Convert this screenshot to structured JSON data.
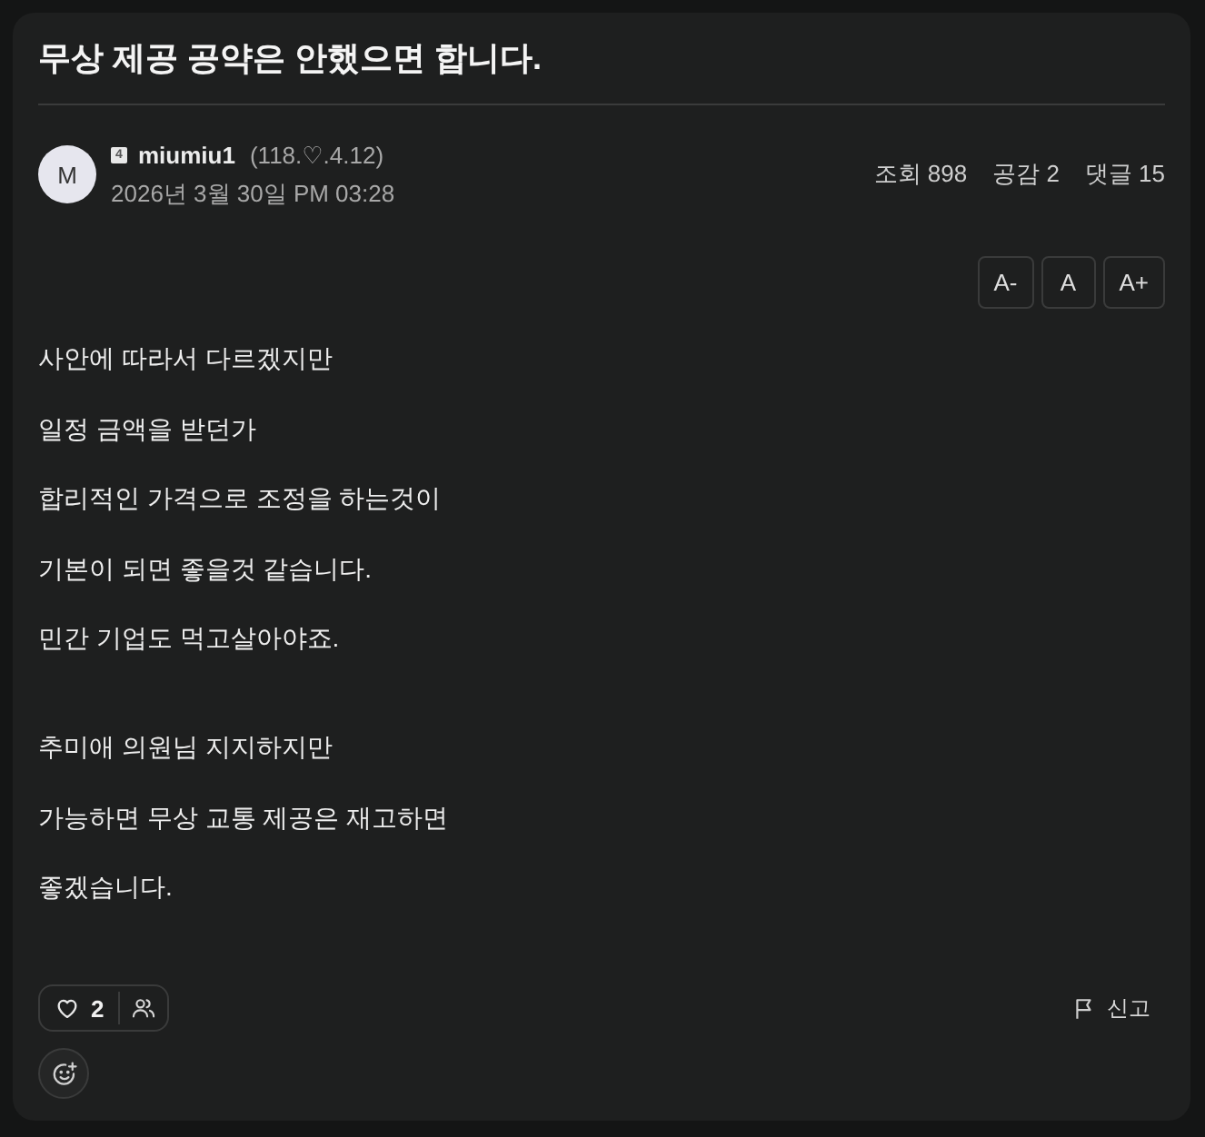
{
  "post": {
    "title": "무상 제공 공약은 안했으면 합니다."
  },
  "author": {
    "avatar_letter": "M",
    "level_badge": "4",
    "name": "miumiu1",
    "ip": "(118.♡.4.12)",
    "date": "2026년 3월 30일 PM 03:28"
  },
  "stats": [
    "조회 898",
    "공감 2",
    "댓글 15"
  ],
  "font_size_buttons": [
    "A-",
    "A",
    "A+"
  ],
  "body": [
    {
      "lines": [
        "사안에 따라서 다르겠지만",
        "일정 금액을 받던가",
        "합리적인 가격으로 조정을 하는것이",
        "기본이 되면 좋을것 같습니다.",
        "민간 기업도 먹고살아야죠."
      ]
    },
    {
      "lines": [
        "추미애 의원님 지지하지만",
        "가능하면 무상 교통 제공은 재고하면",
        "좋겠습니다."
      ]
    }
  ],
  "footer": {
    "like_count": "2",
    "report_label": "신고"
  }
}
